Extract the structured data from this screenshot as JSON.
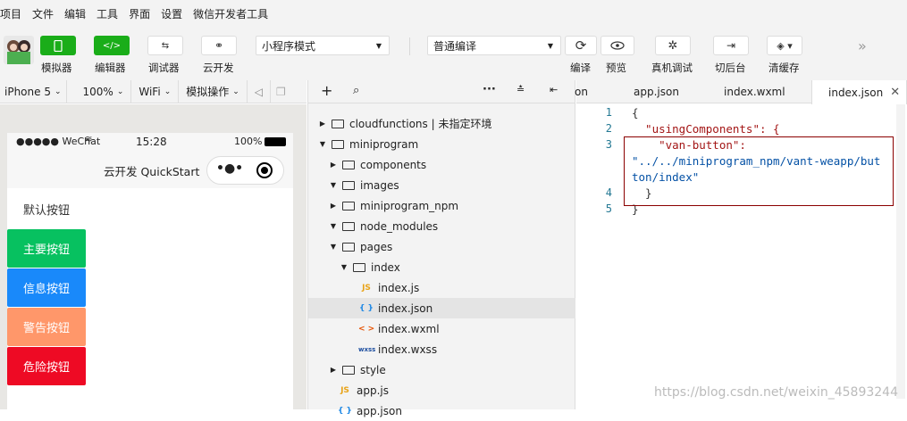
{
  "menu": [
    "项目",
    "文件",
    "编辑",
    "工具",
    "界面",
    "设置",
    "微信开发者工具"
  ],
  "toolbar": {
    "simulator": "模拟器",
    "editor": "编辑器",
    "debugger": "调试器",
    "cloud": "云开发",
    "mode": "小程序模式",
    "compile_mode": "普通编译",
    "compile": "编译",
    "preview": "预览",
    "remote_debug": "真机调试",
    "background": "切后台",
    "clear_cache": "清缓存"
  },
  "simbar": {
    "device": "iPhone 5",
    "zoom": "100%",
    "network": "WiFi",
    "ops": "模拟操作"
  },
  "phone": {
    "carrier": "●●●●● WeChat",
    "time": "15:28",
    "battery": "100%",
    "title": "云开发 QuickStart",
    "buttons": [
      {
        "label": "默认按钮",
        "bg": "#ffffff",
        "fg": "#333333"
      },
      {
        "label": "主要按钮",
        "bg": "#07c160",
        "fg": "#ffffff"
      },
      {
        "label": "信息按钮",
        "bg": "#1989fa",
        "fg": "#ffffff"
      },
      {
        "label": "警告按钮",
        "bg": "#ff976a",
        "fg": "#ffffff"
      },
      {
        "label": "危险按钮",
        "bg": "#ee0a24",
        "fg": "#ffffff"
      }
    ]
  },
  "tree": [
    {
      "label": "cloudfunctions | 未指定环境",
      "type": "folder",
      "arrow": "▶",
      "indent": 0
    },
    {
      "label": "miniprogram",
      "type": "folder",
      "arrow": "▼",
      "indent": 0
    },
    {
      "label": "components",
      "type": "folder",
      "arrow": "▶",
      "indent": 1
    },
    {
      "label": "images",
      "type": "folder",
      "arrow": "▼",
      "indent": 1
    },
    {
      "label": "miniprogram_npm",
      "type": "folder",
      "arrow": "▶",
      "indent": 1
    },
    {
      "label": "node_modules",
      "type": "folder",
      "arrow": "▼",
      "indent": 1
    },
    {
      "label": "pages",
      "type": "folder",
      "arrow": "▼",
      "indent": 1
    },
    {
      "label": "index",
      "type": "folder",
      "arrow": "▼",
      "indent": 2
    },
    {
      "label": "index.js",
      "type": "js",
      "icon": "JS",
      "indent": 3
    },
    {
      "label": "index.json",
      "type": "json",
      "icon": "{ }",
      "indent": 3,
      "selected": true
    },
    {
      "label": "index.wxml",
      "type": "wxml",
      "icon": "< >",
      "indent": 3
    },
    {
      "label": "index.wxss",
      "type": "wxss",
      "icon": "wxss",
      "indent": 3
    },
    {
      "label": "style",
      "type": "folder",
      "arrow": "▶",
      "indent": 1
    },
    {
      "label": "app.js",
      "type": "js",
      "icon": "JS",
      "indent": 1
    },
    {
      "label": "app.json",
      "type": "json",
      "icon": "{ }",
      "indent": 1
    }
  ],
  "tabs": [
    "on",
    "app.json",
    "index.wxml",
    "index.json"
  ],
  "code": [
    {
      "n": "1",
      "text": "{"
    },
    {
      "n": "2",
      "text": "  \"usingComponents\": {"
    },
    {
      "n": "3",
      "text": "    \"van-button\":"
    },
    {
      "n": "",
      "text": "\"../../miniprogram_npm/vant-weapp/but"
    },
    {
      "n": "",
      "text": "ton/index\""
    },
    {
      "n": "4",
      "text": "  }"
    },
    {
      "n": "5",
      "text": "}"
    }
  ],
  "watermark": "https://blog.csdn.net/weixin_45893244"
}
